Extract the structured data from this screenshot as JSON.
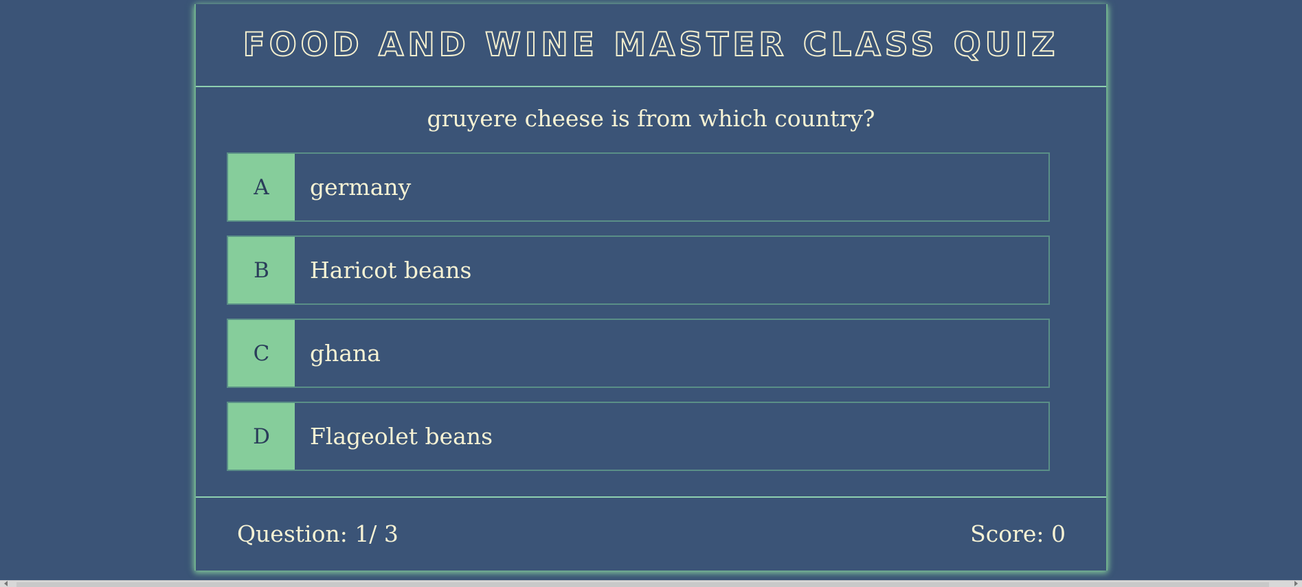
{
  "header": {
    "title": "Food and Wine Master Class Quiz"
  },
  "question": {
    "text": "gruyere cheese is from which country?"
  },
  "answers": [
    {
      "letter": "A",
      "text": "germany"
    },
    {
      "letter": "B",
      "text": "Haricot beans"
    },
    {
      "letter": "C",
      "text": "ghana"
    },
    {
      "letter": "D",
      "text": "Flageolet beans"
    }
  ],
  "footer": {
    "question_counter": "Question: 1/ 3",
    "score": "Score: 0"
  },
  "colors": {
    "background": "#3b5477",
    "accent": "#86cd9b",
    "text": "#f6f2d4"
  }
}
